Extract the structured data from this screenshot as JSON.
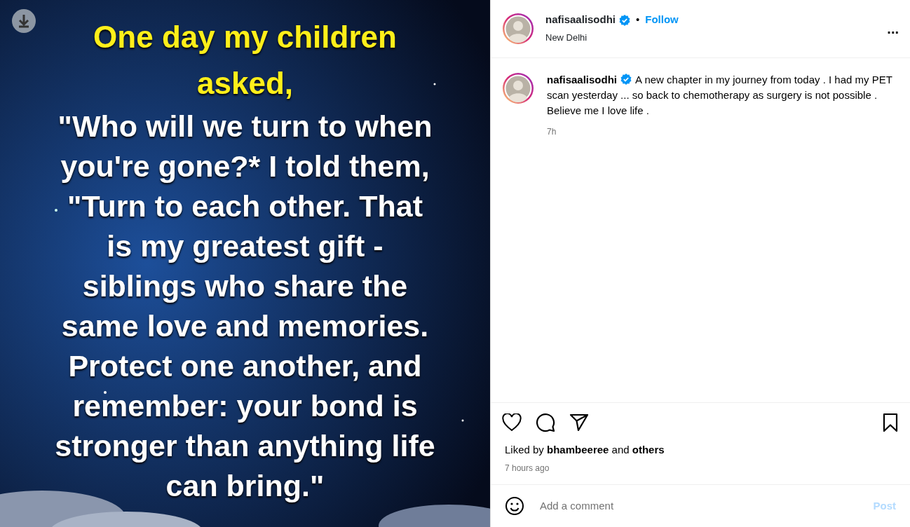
{
  "post_image": {
    "kind": "picture",
    "title_lines": [
      "One day my children",
      "asked,"
    ],
    "quote_lines": [
      "\"Who will we turn to when",
      "you're gone?* I told them,",
      "\"Turn to each other. That",
      "is my greatest gift -",
      "siblings who share the",
      "same love and memories.",
      "Protect one another, and",
      "remember: your bond is",
      "stronger than anything life",
      "can bring.\""
    ]
  },
  "header": {
    "username": "nafisaalisodhi",
    "verified": true,
    "separator": "•",
    "follow": "Follow",
    "location": "New Delhi",
    "more": "..."
  },
  "caption": {
    "username": "nafisaalisodhi",
    "verified": true,
    "text": "A new chapter in my journey from today . I had my PET scan yesterday ... so back to chemotherapy as surgery is not possible . Believe me I love life .",
    "time": "7h"
  },
  "actions": {
    "liked": false,
    "saved": false
  },
  "likes": {
    "prefix": "Liked by",
    "user": "bhambeeree",
    "joiner": "and",
    "others": "others"
  },
  "timestamp": "7 hours ago",
  "comment": {
    "placeholder": "Add a comment",
    "post": "Post"
  }
}
